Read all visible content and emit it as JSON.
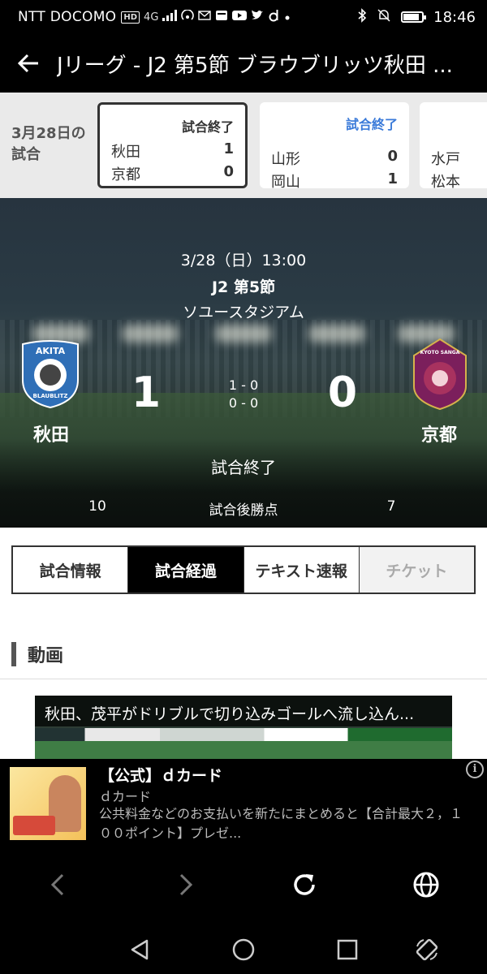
{
  "status_bar": {
    "carrier": "NTT DOCOMO",
    "hd_badge": "HD",
    "network": "4G",
    "time": "18:46",
    "battery_level": 0.85
  },
  "app_bar": {
    "title": "Jリーグ - J2 第5節 ブラウブリッツ秋田 ..."
  },
  "match_strip": {
    "date_label": "3月28日の試合",
    "cards": [
      {
        "status": "試合終了",
        "home": "秋田",
        "home_score": "1",
        "away": "京都",
        "away_score": "0"
      },
      {
        "status": "試合終了",
        "home": "山形",
        "home_score": "0",
        "away": "岡山",
        "away_score": "1"
      },
      {
        "status": "",
        "home": "水戸",
        "home_score": "",
        "away": "松本",
        "away_score": ""
      }
    ]
  },
  "match": {
    "datetime": "3/28（日）13:00",
    "section": "J2 第5節",
    "venue": "ソユースタジアム",
    "home": {
      "name": "秋田",
      "score": "1",
      "points": "10",
      "logo_top": "AKITA",
      "logo_bottom": "BLAUBLITZ",
      "logo_color": "#2f6fb7"
    },
    "away": {
      "name": "京都",
      "score": "0",
      "points": "7",
      "logo_text": "KYOTO SANGA",
      "logo_color": "#7b1f5c"
    },
    "half1": "1 - 0",
    "half2": "0 - 0",
    "status": "試合終了",
    "points_label": "試合後勝点"
  },
  "tabs": [
    {
      "label": "試合情報",
      "state": "normal"
    },
    {
      "label": "試合経過",
      "state": "active"
    },
    {
      "label": "テキスト速報",
      "state": "normal"
    },
    {
      "label": "チケット",
      "state": "disabled"
    }
  ],
  "video_section": {
    "heading": "動画",
    "video_title": "秋田、茂平がドリブルで切り込みゴールへ流し込ん..."
  },
  "ad": {
    "title": "【公式】ｄカード",
    "source": "ｄカード",
    "description": "公共料金などのお支払いを新たにまとめると【合計最大２，１００ポイント】プレゼ...",
    "info": "i"
  },
  "browser_bar": {
    "icons": [
      "back-icon",
      "forward-icon",
      "reload-icon",
      "globe-icon"
    ]
  },
  "nav_bar": {
    "icons": [
      "nav-back-icon",
      "home-icon",
      "recents-icon",
      "rotate-icon"
    ]
  }
}
